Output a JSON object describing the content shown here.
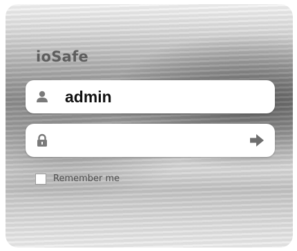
{
  "login": {
    "brand": "ioSafe",
    "username": {
      "value": "admin",
      "icon": "user-icon"
    },
    "password": {
      "value": "",
      "icon": "lock-icon",
      "submit_icon": "arrow-right-icon"
    },
    "remember_me": {
      "label": "Remember me",
      "checked": false
    }
  },
  "colors": {
    "brand_text": "#5e5e5e",
    "field_background": "#ffffff",
    "icon_gray": "#777777"
  }
}
